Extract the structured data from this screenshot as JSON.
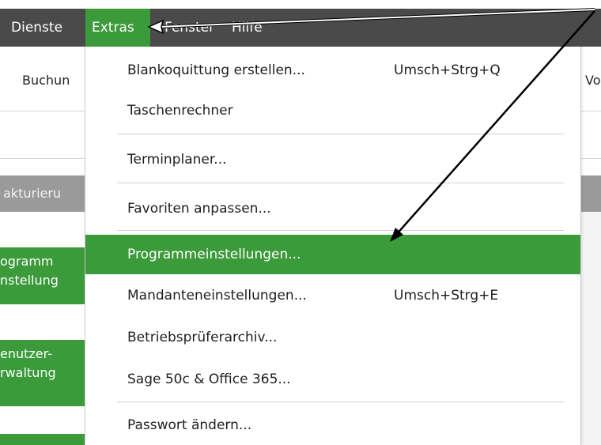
{
  "menubar": {
    "items": [
      {
        "label": "Dienste"
      },
      {
        "label": "Extras",
        "active": true
      },
      {
        "label": "Fenster"
      },
      {
        "label": "Hilfe"
      }
    ]
  },
  "background": {
    "toolbar_left": "Buchun",
    "toolbar_right": "Vor",
    "section_label": "akturieru",
    "button1": "ogramm\nnstellung",
    "button2": "enutzer-\nrwaltung"
  },
  "dropdown": {
    "items": [
      {
        "label": "Blankoquittung erstellen...",
        "shortcut": "Umsch+Strg+Q"
      },
      {
        "label": "Taschenrechner",
        "shortcut": ""
      },
      {
        "label": "Terminplaner...",
        "shortcut": ""
      },
      {
        "label": "Favoriten anpassen...",
        "shortcut": ""
      },
      {
        "label": "Programmeinstellungen...",
        "shortcut": "",
        "highlighted": true
      },
      {
        "label": "Mandanteneinstellungen...",
        "shortcut": "Umsch+Strg+E"
      },
      {
        "label": "Betriebsprüferarchiv...",
        "shortcut": ""
      },
      {
        "label": "Sage 50c & Office 365...",
        "shortcut": ""
      },
      {
        "label": "Passwort ändern...",
        "shortcut": ""
      }
    ]
  },
  "colors": {
    "accent_green": "#3b9a3a",
    "menubar_bg": "#4a4a4a",
    "section_bar": "#9a9a9a"
  }
}
